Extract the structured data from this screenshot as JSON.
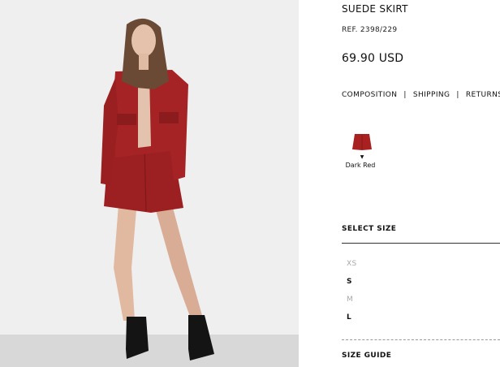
{
  "product": {
    "title": "SUEDE SKIRT",
    "ref": "REF. 2398/229",
    "price": "69.90 USD"
  },
  "links": {
    "composition": "COMPOSITION",
    "separator": "|",
    "shipping": "SHIPPING",
    "returns": "RETURNS"
  },
  "colors": [
    {
      "name": "Dark Red",
      "hex": "#a8201f",
      "selected": true
    }
  ],
  "sizes": {
    "heading": "SELECT SIZE",
    "options": [
      {
        "label": "XS",
        "available": false
      },
      {
        "label": "S",
        "available": true
      },
      {
        "label": "M",
        "available": false
      },
      {
        "label": "L",
        "available": true
      }
    ]
  },
  "size_guide": "SIZE GUIDE",
  "photo": {
    "icon": "product-photo",
    "garment_color": "#9c2022"
  }
}
